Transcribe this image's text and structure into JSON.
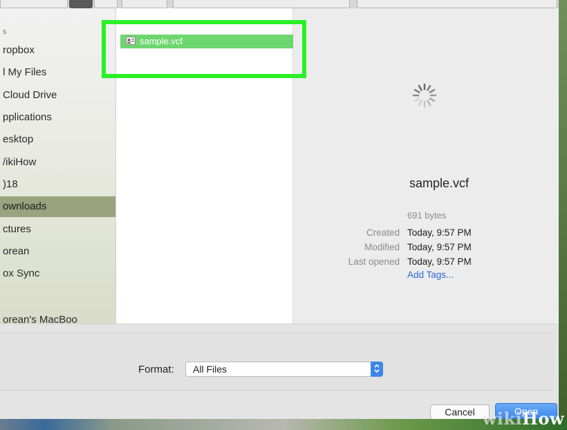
{
  "sidebar": {
    "items": [
      {
        "label": "s",
        "type": "header"
      },
      {
        "label": "ropbox"
      },
      {
        "label": "l My Files"
      },
      {
        "label": "Cloud Drive"
      },
      {
        "label": "pplications"
      },
      {
        "label": "esktop"
      },
      {
        "label": "/ikiHow"
      },
      {
        "label": ")18"
      },
      {
        "label": "ownloads",
        "selected": true
      },
      {
        "label": "ctures"
      },
      {
        "label": "orean"
      },
      {
        "label": "ox Sync"
      },
      {
        "label": "orean's MacBoo"
      }
    ]
  },
  "file_list": {
    "selected_file": "sample.vcf"
  },
  "preview": {
    "file_name": "sample.vcf",
    "size": "691 bytes",
    "created_label": "Created",
    "created_value": "Today, 9:57 PM",
    "modified_label": "Modified",
    "modified_value": "Today, 9:57 PM",
    "last_opened_label": "Last opened",
    "last_opened_value": "Today, 9:57 PM",
    "add_tags": "Add Tags..."
  },
  "format": {
    "label": "Format:",
    "value": "All Files"
  },
  "buttons": {
    "cancel": "Cancel",
    "open": "Open"
  },
  "watermark": {
    "part1": "wiki",
    "part2": "How"
  },
  "colors": {
    "highlight": "#29f027",
    "selected_row": "#6ed66e",
    "sidebar_selected": "#9aa27f",
    "accent_blue": "#3b85ea",
    "link": "#2c6ad6"
  }
}
